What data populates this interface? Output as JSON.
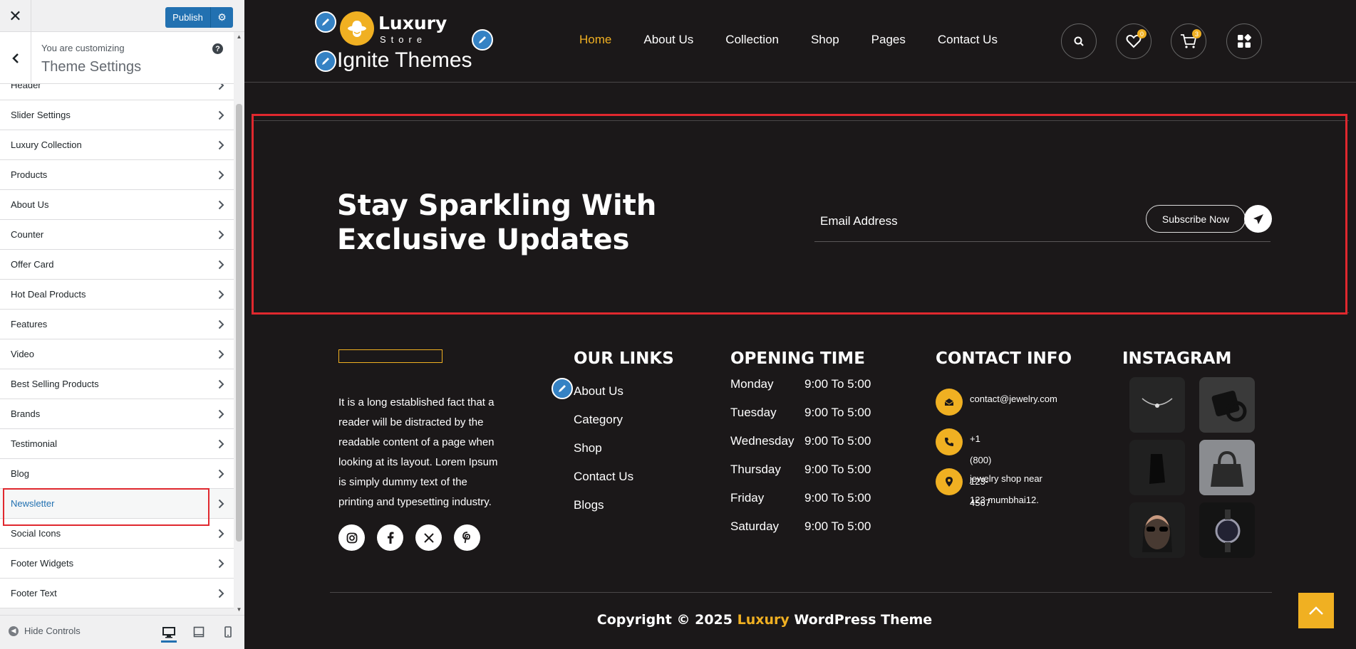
{
  "customizer": {
    "close_icon": "close-icon",
    "publish_label": "Publish",
    "customizing_label": "You are customizing",
    "panel_title": "Theme Settings",
    "sections": [
      {
        "label": "Header"
      },
      {
        "label": "Slider Settings"
      },
      {
        "label": "Luxury Collection"
      },
      {
        "label": "Products"
      },
      {
        "label": "About Us"
      },
      {
        "label": "Counter"
      },
      {
        "label": "Offer Card"
      },
      {
        "label": "Hot Deal Products"
      },
      {
        "label": "Features"
      },
      {
        "label": "Video"
      },
      {
        "label": "Best Selling Products"
      },
      {
        "label": "Brands"
      },
      {
        "label": "Testimonial"
      },
      {
        "label": "Blog"
      },
      {
        "label": "Newsletter"
      },
      {
        "label": "Social Icons"
      },
      {
        "label": "Footer Widgets"
      },
      {
        "label": "Footer Text"
      }
    ],
    "active_section": "Newsletter",
    "hide_controls_label": "Hide Controls",
    "accent_color": "#2271b1",
    "highlight_color": "#e0282e"
  },
  "site": {
    "logo_text": "Luxury",
    "logo_sub": "Store",
    "site_title": "Ignite Themes",
    "nav": [
      "Home",
      "About Us",
      "Collection",
      "Shop",
      "Pages",
      "Contact Us"
    ],
    "active_nav": "Home",
    "wishlist_count": "0",
    "cart_count": "3",
    "accent_color": "#f0b022",
    "background_color": "#1b1819"
  },
  "newsletter": {
    "heading": "Stay Sparkling With Exclusive Updates",
    "email_placeholder": "Email Address",
    "subscribe_label": "Subscribe Now"
  },
  "footer": {
    "about_text": "It is a long established fact that a reader will be distracted by the readable content of a page when looking at its layout. Lorem Ipsum is simply dummy text of the printing and typesetting industry.",
    "social_icons": [
      "instagram-icon",
      "facebook-icon",
      "x-icon",
      "pinterest-icon"
    ],
    "links_heading": "OUR LINKS",
    "links": [
      "About Us",
      "Category",
      "Shop",
      "Contact Us",
      "Blogs"
    ],
    "hours_heading": "OPENING TIME",
    "hours": [
      {
        "day": "Monday",
        "time": "9:00 To 5:00"
      },
      {
        "day": "Tuesday",
        "time": "9:00 To 5:00"
      },
      {
        "day": "Wednesday",
        "time": "9:00 To 5:00"
      },
      {
        "day": "Thursday",
        "time": "9:00 To 5:00"
      },
      {
        "day": "Friday",
        "time": "9:00 To 5:00"
      },
      {
        "day": "Saturday",
        "time": "9:00 To 5:00"
      }
    ],
    "contact_heading": "CONTACT INFO",
    "contact": {
      "email": "contact@jewelry.com",
      "phone": "+1 (800) 123-4567",
      "address": "jewelry shop near 123 mumbhai12."
    },
    "instagram_heading": "INSTAGRAM",
    "copyright_prefix": "Copyright © 2025",
    "copyright_brand": "Luxury",
    "copyright_suffix": "WordPress Theme"
  }
}
